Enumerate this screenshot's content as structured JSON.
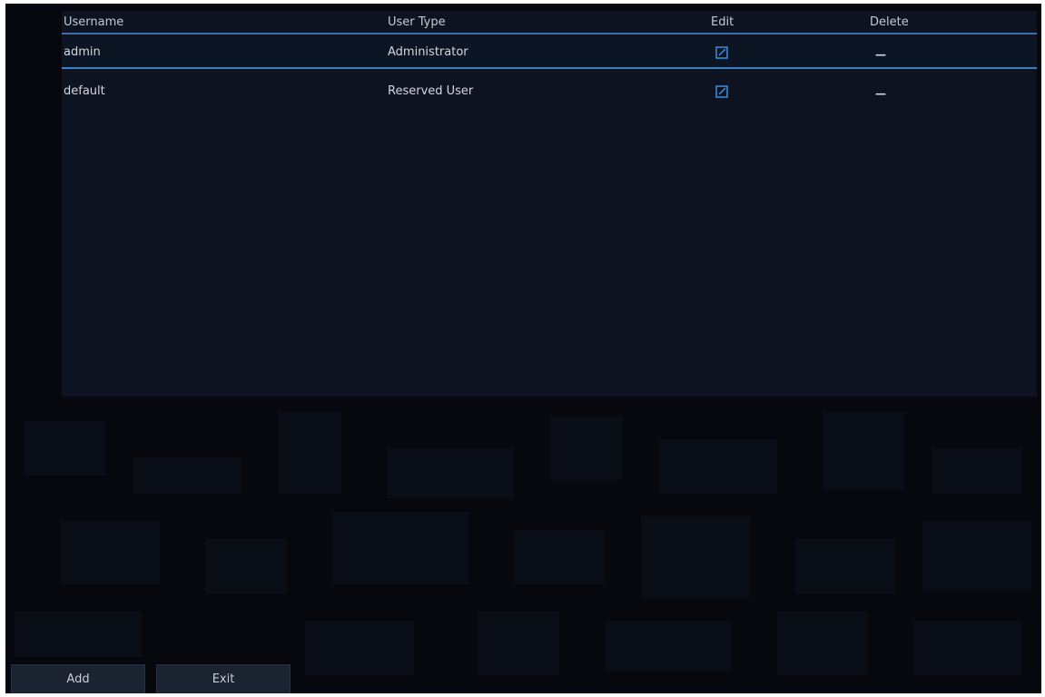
{
  "table": {
    "headers": {
      "username": "Username",
      "user_type": "User Type",
      "edit": "Edit",
      "delete": "Delete"
    },
    "rows": [
      {
        "username": "admin",
        "user_type": "Administrator",
        "edit_icon": "edit-icon",
        "delete_text": "—"
      },
      {
        "username": "default",
        "user_type": "Reserved User",
        "edit_icon": "edit-icon",
        "delete_text": "—"
      }
    ]
  },
  "buttons": {
    "add_label": "Add",
    "exit_label": "Exit"
  },
  "colors": {
    "background": "#06080d",
    "panel": "#0d1320",
    "accent": "#3f7ec0"
  }
}
